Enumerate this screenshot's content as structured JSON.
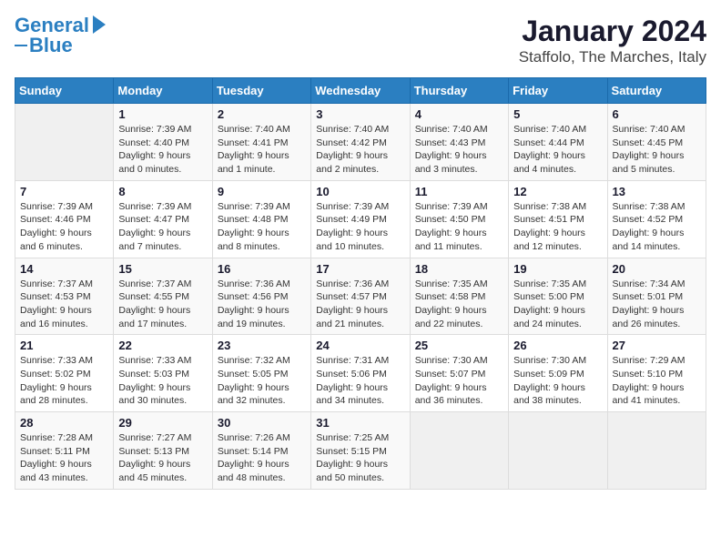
{
  "logo": {
    "line1": "General",
    "line2": "Blue"
  },
  "title": "January 2024",
  "subtitle": "Staffolo, The Marches, Italy",
  "weekdays": [
    "Sunday",
    "Monday",
    "Tuesday",
    "Wednesday",
    "Thursday",
    "Friday",
    "Saturday"
  ],
  "weeks": [
    [
      {
        "day": "",
        "info": ""
      },
      {
        "day": "1",
        "info": "Sunrise: 7:39 AM\nSunset: 4:40 PM\nDaylight: 9 hours\nand 0 minutes."
      },
      {
        "day": "2",
        "info": "Sunrise: 7:40 AM\nSunset: 4:41 PM\nDaylight: 9 hours\nand 1 minute."
      },
      {
        "day": "3",
        "info": "Sunrise: 7:40 AM\nSunset: 4:42 PM\nDaylight: 9 hours\nand 2 minutes."
      },
      {
        "day": "4",
        "info": "Sunrise: 7:40 AM\nSunset: 4:43 PM\nDaylight: 9 hours\nand 3 minutes."
      },
      {
        "day": "5",
        "info": "Sunrise: 7:40 AM\nSunset: 4:44 PM\nDaylight: 9 hours\nand 4 minutes."
      },
      {
        "day": "6",
        "info": "Sunrise: 7:40 AM\nSunset: 4:45 PM\nDaylight: 9 hours\nand 5 minutes."
      }
    ],
    [
      {
        "day": "7",
        "info": "Sunrise: 7:39 AM\nSunset: 4:46 PM\nDaylight: 9 hours\nand 6 minutes."
      },
      {
        "day": "8",
        "info": "Sunrise: 7:39 AM\nSunset: 4:47 PM\nDaylight: 9 hours\nand 7 minutes."
      },
      {
        "day": "9",
        "info": "Sunrise: 7:39 AM\nSunset: 4:48 PM\nDaylight: 9 hours\nand 8 minutes."
      },
      {
        "day": "10",
        "info": "Sunrise: 7:39 AM\nSunset: 4:49 PM\nDaylight: 9 hours\nand 10 minutes."
      },
      {
        "day": "11",
        "info": "Sunrise: 7:39 AM\nSunset: 4:50 PM\nDaylight: 9 hours\nand 11 minutes."
      },
      {
        "day": "12",
        "info": "Sunrise: 7:38 AM\nSunset: 4:51 PM\nDaylight: 9 hours\nand 12 minutes."
      },
      {
        "day": "13",
        "info": "Sunrise: 7:38 AM\nSunset: 4:52 PM\nDaylight: 9 hours\nand 14 minutes."
      }
    ],
    [
      {
        "day": "14",
        "info": "Sunrise: 7:37 AM\nSunset: 4:53 PM\nDaylight: 9 hours\nand 16 minutes."
      },
      {
        "day": "15",
        "info": "Sunrise: 7:37 AM\nSunset: 4:55 PM\nDaylight: 9 hours\nand 17 minutes."
      },
      {
        "day": "16",
        "info": "Sunrise: 7:36 AM\nSunset: 4:56 PM\nDaylight: 9 hours\nand 19 minutes."
      },
      {
        "day": "17",
        "info": "Sunrise: 7:36 AM\nSunset: 4:57 PM\nDaylight: 9 hours\nand 21 minutes."
      },
      {
        "day": "18",
        "info": "Sunrise: 7:35 AM\nSunset: 4:58 PM\nDaylight: 9 hours\nand 22 minutes."
      },
      {
        "day": "19",
        "info": "Sunrise: 7:35 AM\nSunset: 5:00 PM\nDaylight: 9 hours\nand 24 minutes."
      },
      {
        "day": "20",
        "info": "Sunrise: 7:34 AM\nSunset: 5:01 PM\nDaylight: 9 hours\nand 26 minutes."
      }
    ],
    [
      {
        "day": "21",
        "info": "Sunrise: 7:33 AM\nSunset: 5:02 PM\nDaylight: 9 hours\nand 28 minutes."
      },
      {
        "day": "22",
        "info": "Sunrise: 7:33 AM\nSunset: 5:03 PM\nDaylight: 9 hours\nand 30 minutes."
      },
      {
        "day": "23",
        "info": "Sunrise: 7:32 AM\nSunset: 5:05 PM\nDaylight: 9 hours\nand 32 minutes."
      },
      {
        "day": "24",
        "info": "Sunrise: 7:31 AM\nSunset: 5:06 PM\nDaylight: 9 hours\nand 34 minutes."
      },
      {
        "day": "25",
        "info": "Sunrise: 7:30 AM\nSunset: 5:07 PM\nDaylight: 9 hours\nand 36 minutes."
      },
      {
        "day": "26",
        "info": "Sunrise: 7:30 AM\nSunset: 5:09 PM\nDaylight: 9 hours\nand 38 minutes."
      },
      {
        "day": "27",
        "info": "Sunrise: 7:29 AM\nSunset: 5:10 PM\nDaylight: 9 hours\nand 41 minutes."
      }
    ],
    [
      {
        "day": "28",
        "info": "Sunrise: 7:28 AM\nSunset: 5:11 PM\nDaylight: 9 hours\nand 43 minutes."
      },
      {
        "day": "29",
        "info": "Sunrise: 7:27 AM\nSunset: 5:13 PM\nDaylight: 9 hours\nand 45 minutes."
      },
      {
        "day": "30",
        "info": "Sunrise: 7:26 AM\nSunset: 5:14 PM\nDaylight: 9 hours\nand 48 minutes."
      },
      {
        "day": "31",
        "info": "Sunrise: 7:25 AM\nSunset: 5:15 PM\nDaylight: 9 hours\nand 50 minutes."
      },
      {
        "day": "",
        "info": ""
      },
      {
        "day": "",
        "info": ""
      },
      {
        "day": "",
        "info": ""
      }
    ]
  ]
}
